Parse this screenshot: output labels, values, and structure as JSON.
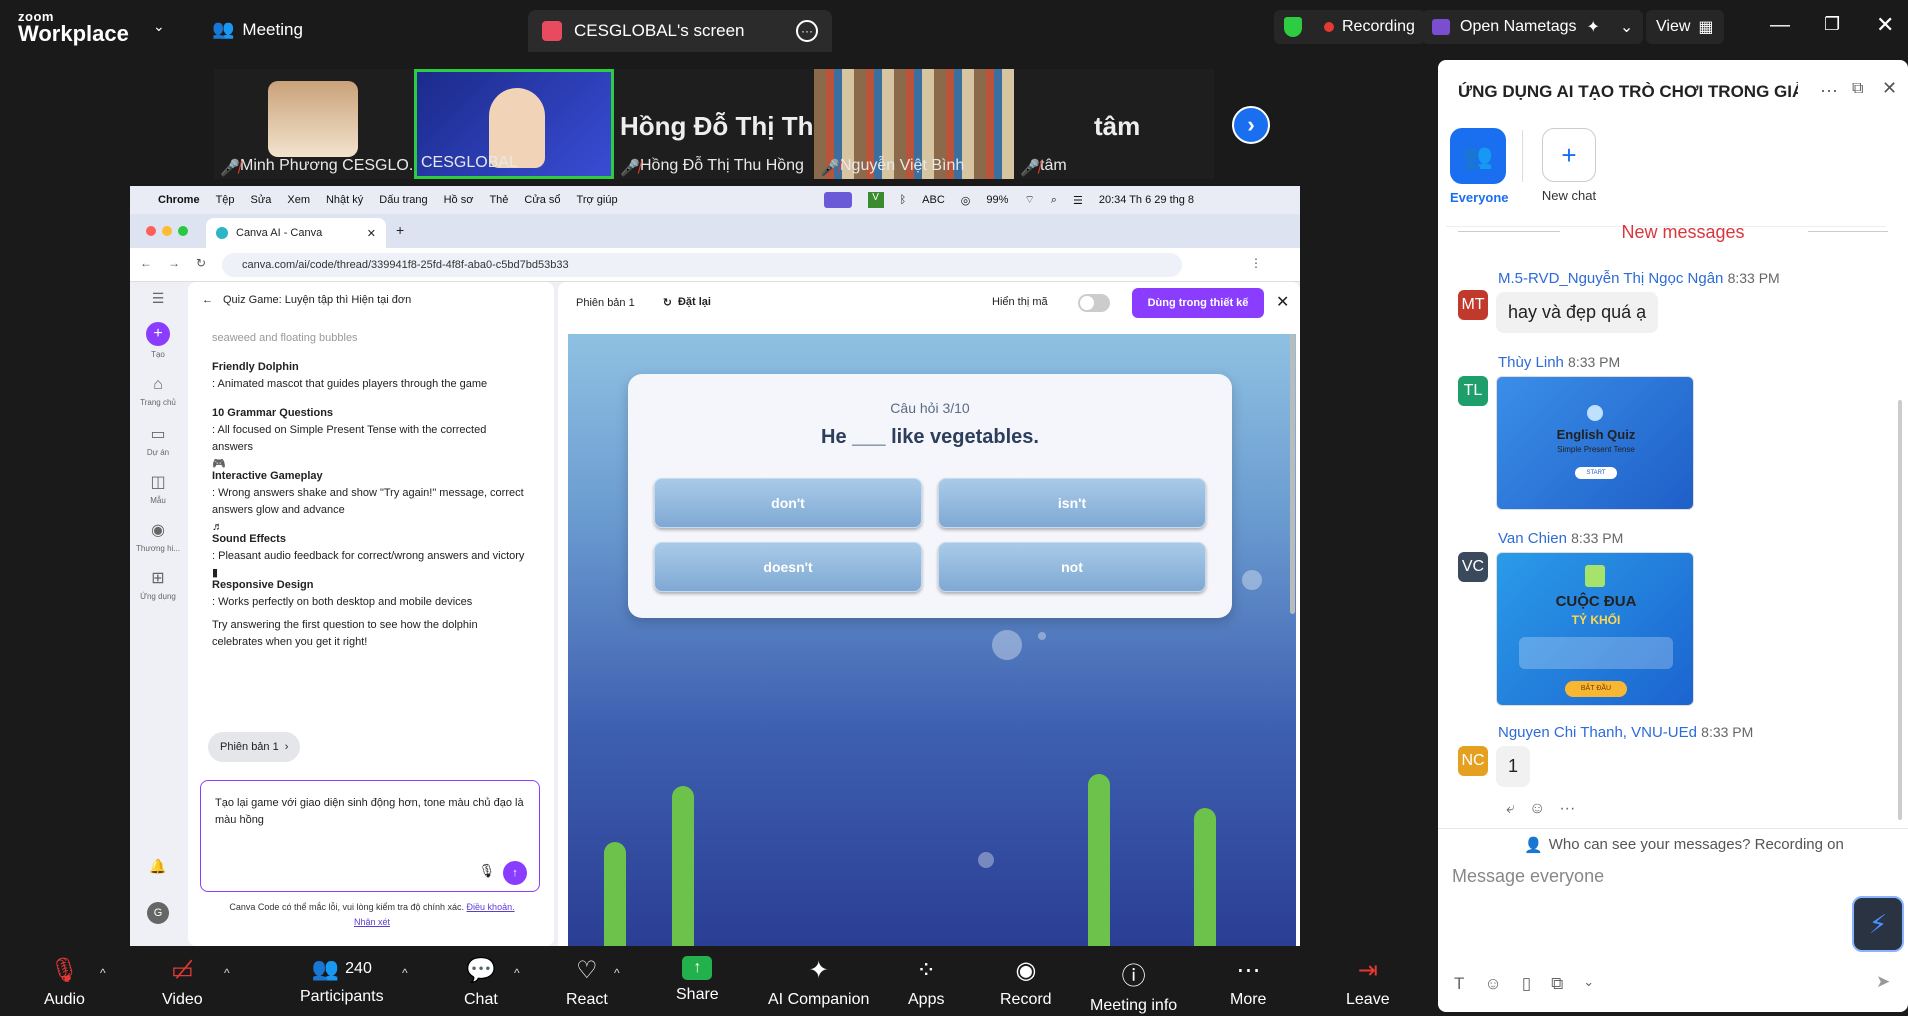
{
  "topbar": {
    "logo_line1": "zoom",
    "logo_line2": "Workplace",
    "meeting_label": "Meeting",
    "share_tab_label": "CESGLOBAL's screen",
    "recording_label": "Recording",
    "nametags_label": "Open Nametags",
    "view_label": "View"
  },
  "participants_strip": [
    {
      "name": "Minh Phương CESGLO..."
    },
    {
      "name": "CESGLOBAL"
    },
    {
      "name": "Hồng Đỗ Thị Thu Hồng",
      "big": "Hồng Đỗ Thị Th..."
    },
    {
      "name": "Nguyễn Việt Bình"
    },
    {
      "name": "tâm",
      "big": "tâm"
    }
  ],
  "mac": {
    "menu": [
      "Chrome",
      "Tệp",
      "Sửa",
      "Xem",
      "Nhật ký",
      "Dấu trang",
      "Hồ sơ",
      "Thẻ",
      "Cửa sổ",
      "Trợ giúp"
    ],
    "battery": "99%",
    "abc": "ABC",
    "clock": "20:34 Th 6 29 thg 8"
  },
  "browser": {
    "tab_title": "Canva AI - Canva",
    "url": "canva.com/ai/code/thread/339941f8-25fd-4f8f-aba0-c5bd7bd53b33"
  },
  "canva_nav": [
    {
      "label": "Tạo"
    },
    {
      "label": "Trang chủ"
    },
    {
      "label": "Dự án"
    },
    {
      "label": "Mẫu"
    },
    {
      "label": "Thương hi..."
    },
    {
      "label": "Ứng dụng"
    }
  ],
  "canva_chat": {
    "title": "Quiz Game: Luyện tập thì Hiện tại đơn",
    "faded": "seaweed and floating bubbles",
    "features": [
      {
        "head": "Friendly Dolphin",
        "desc": ": Animated mascot that guides players through the game"
      },
      {
        "head": "10 Grammar Questions",
        "desc": ": All focused on Simple Present Tense with the corrected answers"
      },
      {
        "head": "Interactive Gameplay",
        "desc": ": Wrong answers shake and show \"Try again!\" message, correct answers glow and advance"
      },
      {
        "head": "Sound Effects",
        "desc": ": Pleasant audio feedback for correct/wrong answers and victory"
      },
      {
        "head": "Responsive Design",
        "desc": ": Works perfectly on both desktop and mobile devices"
      }
    ],
    "closing": "Try answering the first question to see how the dolphin celebrates when you get it right!",
    "version_chip": "Phiên bản 1",
    "input_text": "Tạo lại game với giao diện sinh động hơn, tone màu chủ đạo là màu hồng",
    "disclaimer": "Canva Code có thể mắc lỗi, vui lòng kiểm tra độ chính xác.",
    "terms": "Điều khoản.",
    "feedback": "Nhận xét",
    "user_initial": "G"
  },
  "preview": {
    "version": "Phiên bản 1",
    "reset": "Đặt lại",
    "show_code": "Hiển thị mã",
    "use_design": "Dùng trong thiết kế",
    "question_num": "Câu hỏi 3/10",
    "question": "He ___ like vegetables.",
    "answers": [
      "don't",
      "isn't",
      "doesn't",
      "not"
    ]
  },
  "chat_panel": {
    "title": "ỨNG DỤNG AI TẠO TRÒ CHƠI TRONG GIẢN...",
    "everyone": "Everyone",
    "new_chat": "New chat",
    "new_messages": "New messages",
    "messages": [
      {
        "initials": "MT",
        "color": "#c0392b",
        "name": "M.5-RVD_Nguyễn Thị Ngọc Ngân",
        "time": "8:33 PM",
        "text": "hay và đẹp quá ạ"
      },
      {
        "initials": "TL",
        "color": "#1e9e6a",
        "name": "Thùy Linh",
        "time": "8:33 PM",
        "image_title": "English Quiz",
        "image_sub": "Simple Present Tense",
        "image_btn": "START"
      },
      {
        "initials": "VC",
        "color": "#3a4a5c",
        "name": "Van Chien",
        "time": "8:33 PM",
        "image_title": "CUỘC ĐUA",
        "image_sub": "TỶ KHỐI",
        "image_btn": "BẮT ĐẦU"
      },
      {
        "initials": "NC",
        "color": "#e6a020",
        "name": "Nguyen Chi Thanh, VNU-UEd",
        "time": "8:33 PM",
        "text": "1"
      }
    ],
    "privacy": "Who can see your messages? Recording on",
    "placeholder": "Message everyone"
  },
  "bottombar": {
    "audio": "Audio",
    "video": "Video",
    "participants": "Participants",
    "participants_count": "240",
    "chat": "Chat",
    "react": "React",
    "share": "Share",
    "ai": "AI Companion",
    "apps": "Apps",
    "record": "Record",
    "info": "Meeting info",
    "more": "More",
    "leave": "Leave"
  }
}
